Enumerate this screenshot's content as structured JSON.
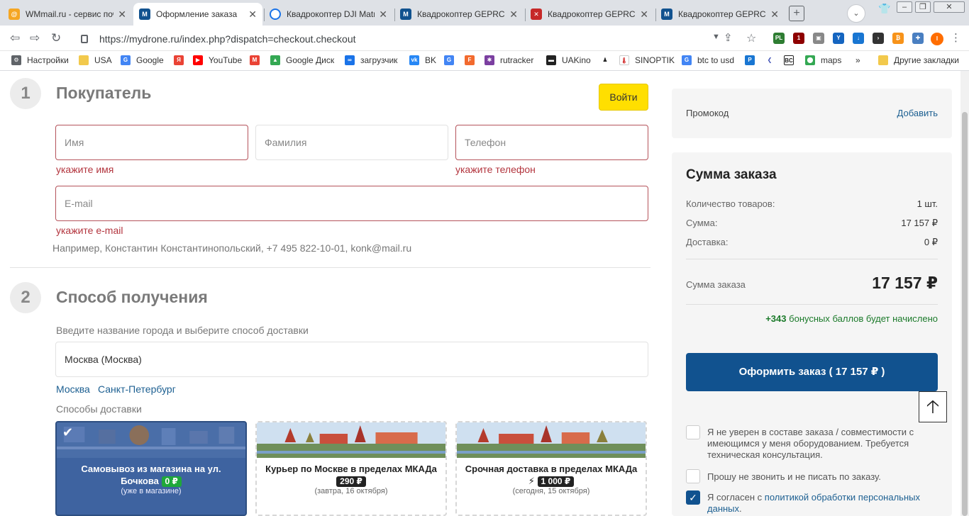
{
  "tabs": [
    {
      "title": "WMmail.ru - сервис почтовых",
      "active": false,
      "fav_color": "#f5a623",
      "fav_text": ""
    },
    {
      "title": "Оформление заказа",
      "active": true,
      "fav_color": "#11528f",
      "fav_text": "M"
    },
    {
      "title": "Квадрокоптер DJI Matrice",
      "active": false,
      "fav_color": "#1a73e8",
      "fav_text": ""
    },
    {
      "title": "Квадрокоптер GEPRC C",
      "active": false,
      "fav_color": "#11528f",
      "fav_text": "M"
    },
    {
      "title": "Квадрокоптер GEPRC C",
      "active": false,
      "fav_color": "#c62828",
      "fav_text": "M"
    },
    {
      "title": "Квадрокоптер GEPRC C",
      "active": false,
      "fav_color": "#11528f",
      "fav_text": "M"
    }
  ],
  "browser": {
    "url": "https://mydrone.ru/index.php?dispatch=checkout.checkout",
    "new_tab": "+",
    "profile_initial": "⌄",
    "avatar_initial": "I"
  },
  "bookmarks": [
    {
      "label": "Настройки",
      "color": "#5f6368"
    },
    {
      "label": "USA",
      "color": "#f2c94c"
    },
    {
      "label": "Google",
      "color": "#4285f4"
    },
    {
      "label": "",
      "color": "#ea4335"
    },
    {
      "label": "YouTube",
      "color": "#ff0000"
    },
    {
      "label": "",
      "color": "#ea4335"
    },
    {
      "label": "Google Диск",
      "color": "#34a853"
    },
    {
      "label": "загрузчик",
      "color": "#1a73e8"
    },
    {
      "label": "BK",
      "color": "#2787f5"
    },
    {
      "label": "",
      "color": "#4285f4"
    },
    {
      "label": "",
      "color": "#f26a2e"
    },
    {
      "label": "rutracker",
      "color": "#7b3fa0"
    },
    {
      "label": "UAKino",
      "color": "#222"
    },
    {
      "label": "",
      "color": "#333"
    },
    {
      "label": "SINOPTIK",
      "color": "#d32f2f"
    },
    {
      "label": "btc to usd",
      "color": "#4285f4"
    },
    {
      "label": "",
      "color": "#1976d2"
    },
    {
      "label": "",
      "color": "#3f51b5"
    },
    {
      "label": "",
      "color": "#222"
    },
    {
      "label": "maps",
      "color": "#34a853"
    },
    {
      "label": "»",
      "color": ""
    },
    {
      "label": "Другие закладки",
      "color": "#f2c94c"
    }
  ],
  "step1": {
    "number": "1",
    "title": "Покупатель",
    "login": "Войти"
  },
  "fields": {
    "name": {
      "placeholder": "Имя",
      "error": "укажите имя"
    },
    "lastname": {
      "placeholder": "Фамилия"
    },
    "phone": {
      "placeholder": "Телефон",
      "error": "укажите телефон"
    },
    "email": {
      "placeholder": "E-mail",
      "error": "укажите e-mail"
    },
    "example": "Например, Константин Константинопольский, +7 495 822-10-01, konk@mail.ru"
  },
  "step2": {
    "number": "2",
    "title": "Способ получения",
    "city_prompt": "Введите название города и выберите способ доставки",
    "city_value": "Москва (Москва)",
    "city_links": [
      "Москва",
      "Санкт-Петербург"
    ],
    "methods_label": "Способы доставки"
  },
  "delivery": [
    {
      "title": "Самовывоз из магазина на ул. Бочкова",
      "price": "0 ₽",
      "sub": "(уже в магазине)",
      "selected": true
    },
    {
      "title": "Курьер по Москве в пределах МКАДа",
      "price": "290 ₽",
      "sub": "(завтра, 16 октября)",
      "selected": false
    },
    {
      "title": "Срочная доставка в пределах МКАДа ⚡",
      "price": "1 000 ₽",
      "sub": "(сегодня, 15 октября)",
      "selected": false
    }
  ],
  "promo": {
    "label": "Промокод",
    "action": "Добавить"
  },
  "summary": {
    "title": "Сумма заказа",
    "rows": [
      {
        "label": "Количество товаров:",
        "value": "1 шт."
      },
      {
        "label": "Сумма:",
        "value": "17 157 ₽"
      },
      {
        "label": "Доставка:",
        "value": "0 ₽"
      }
    ],
    "total_label": "Сумма заказа",
    "total_value": "17 157 ₽",
    "bonus_amount": "+343",
    "bonus_text": "бонусных баллов будет начислено",
    "order_button": "Оформить заказ ( 17 157 ₽ )"
  },
  "checkboxes": [
    {
      "text": "Я не уверен в составе заказа / совместимости с имеющимся у меня оборудованием. Требуется техническая консультация.",
      "checked": false
    },
    {
      "text": "Прошу не звонить и не писать по заказу.",
      "checked": false
    },
    {
      "text_prefix": "Я согласен с ",
      "link": "политикой обработки персональных данных",
      "text_suffix": ".",
      "checked": true
    }
  ],
  "colors": {
    "accent": "#11528f",
    "login_yellow": "#ffdf00",
    "error": "#b3353e",
    "bonus_green": "#1b7a2a"
  }
}
